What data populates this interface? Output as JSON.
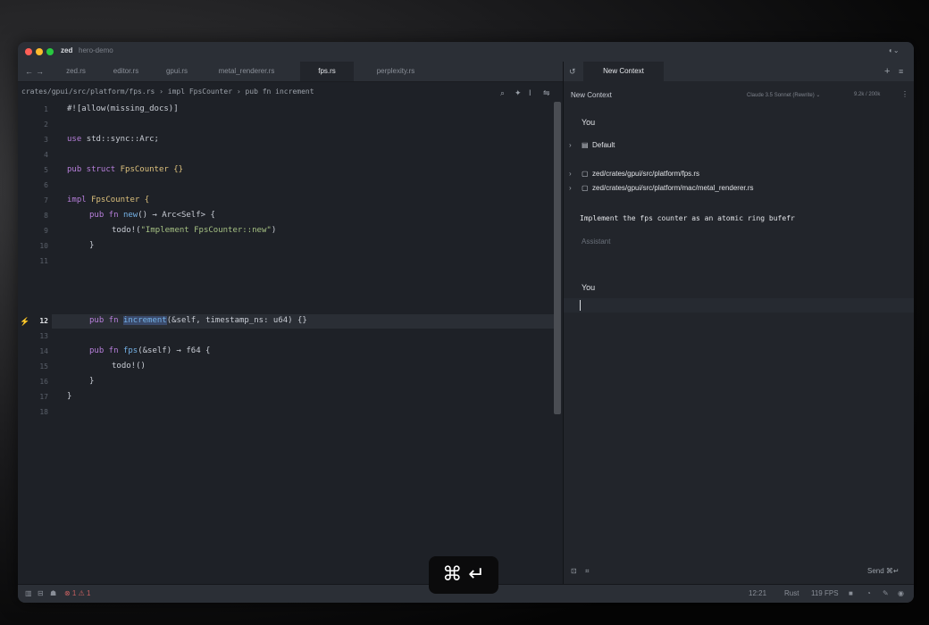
{
  "titlebar": {
    "app": "zed",
    "project": "hero-demo"
  },
  "tabs": [
    "zed.rs",
    "editor.rs",
    "gpui.rs",
    "metal_renderer.rs",
    "fps.rs",
    "perplexity.rs"
  ],
  "active_tab": "fps.rs",
  "breadcrumb": "crates/gpui/src/platform/fps.rs › impl FpsCounter › pub fn increment",
  "panel": {
    "tab": "New Context",
    "title": "New Context",
    "model": "Claude 3.5 Sonnet (Rewrite) ⌄",
    "tokens": "9.2k / 200k",
    "you1": "You",
    "default": "Default",
    "file1": "zed/crates/gpui/src/platform/fps.rs",
    "file2": "zed/crates/gpui/src/platform/mac/metal_renderer.rs",
    "prompt": "Implement the fps counter as an atomic ring bufefr",
    "assistant": "Assistant",
    "you2": "You",
    "send": "Send ⌘↵"
  },
  "code": {
    "lines": [
      "1",
      "2",
      "3",
      "4",
      "5",
      "6",
      "7",
      "8",
      "9",
      "10",
      "11",
      "12",
      "13",
      "14",
      "15",
      "16",
      "17",
      "18"
    ],
    "l1": "#![allow(missing_docs)]",
    "l3a": "use ",
    "l3b": "std::sync::Arc;",
    "l5a": "pub struct ",
    "l5b": "FpsCounter {}",
    "l7a": "impl ",
    "l7b": "FpsCounter {",
    "l8a": "pub fn ",
    "l8b": "new",
    "l8c": "() → Arc<Self> {",
    "l9a": "todo!(",
    "l9b": "\"Implement FpsCounter::new\"",
    "l9c": ")",
    "l10": "}",
    "l12a": "pub fn ",
    "l12b": "increment",
    "l12c": "(&self, timestamp_ns: u64) {}",
    "l14a": "pub fn ",
    "l14b": "fps",
    "l14c": "(&self) → f64 {",
    "l15": "todo!()",
    "l16": "}",
    "l17": "}"
  },
  "status": {
    "errors": "⊗ 1 ⚠ 1",
    "time": "12:21",
    "lang": "Rust",
    "fps": "119 FPS"
  },
  "shortcut": "⌘ ↵"
}
